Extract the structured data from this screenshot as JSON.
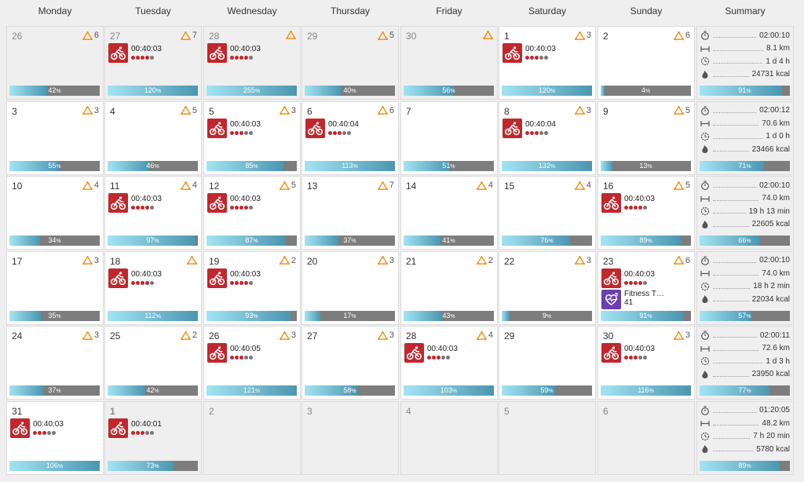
{
  "headers": [
    "Monday",
    "Tuesday",
    "Wednesday",
    "Thursday",
    "Friday",
    "Saturday",
    "Sunday",
    "Summary"
  ],
  "weeks": [
    {
      "days": [
        {
          "num": "26",
          "other": true,
          "load": "6",
          "bar": 42
        },
        {
          "num": "27",
          "other": true,
          "load": "7",
          "bar": 120,
          "activity": {
            "duration": "00:40:03",
            "dots": 4
          }
        },
        {
          "num": "28",
          "other": true,
          "load": "",
          "bar": 255,
          "activity": {
            "duration": "00:40:03",
            "dots": 4
          }
        },
        {
          "num": "29",
          "other": true,
          "load": "5",
          "bar": 40
        },
        {
          "num": "30",
          "other": true,
          "load": "",
          "bar": 56
        },
        {
          "num": "1",
          "load": "3",
          "bar": 120,
          "activity": {
            "duration": "00:40:03",
            "dots": 3
          }
        },
        {
          "num": "2",
          "load": "6",
          "bar": 4
        }
      ],
      "summary": {
        "time": "02:00:10",
        "distance": "8.1 km",
        "duration": "1 d 4 h",
        "energy": "24731 kcal",
        "bar": 91
      }
    },
    {
      "days": [
        {
          "num": "3",
          "load": "3",
          "bar": 55
        },
        {
          "num": "4",
          "load": "5",
          "bar": 46
        },
        {
          "num": "5",
          "load": "3",
          "bar": 85,
          "activity": {
            "duration": "00:40:03",
            "dots": 3
          }
        },
        {
          "num": "6",
          "load": "6",
          "bar": 113,
          "activity": {
            "duration": "00:40:04",
            "dots": 3
          }
        },
        {
          "num": "7",
          "load": null,
          "bar": 51
        },
        {
          "num": "8",
          "load": "3",
          "bar": 132,
          "activity": {
            "duration": "00:40:04",
            "dots": 3
          }
        },
        {
          "num": "9",
          "load": "5",
          "bar": 13
        }
      ],
      "summary": {
        "time": "02:00:12",
        "distance": "70.6 km",
        "duration": "1 d 0 h",
        "energy": "23466 kcal",
        "bar": 71
      }
    },
    {
      "days": [
        {
          "num": "10",
          "load": "4",
          "bar": 34
        },
        {
          "num": "11",
          "load": "4",
          "bar": 97,
          "activity": {
            "duration": "00:40:03",
            "dots": 4
          }
        },
        {
          "num": "12",
          "load": "5",
          "bar": 87,
          "activity": {
            "duration": "00:40:03",
            "dots": 4
          }
        },
        {
          "num": "13",
          "load": "7",
          "bar": 37
        },
        {
          "num": "14",
          "load": "4",
          "bar": 41
        },
        {
          "num": "15",
          "load": "4",
          "bar": 76
        },
        {
          "num": "16",
          "load": "5",
          "bar": 89,
          "activity": {
            "duration": "00:40:03",
            "dots": 4
          }
        }
      ],
      "summary": {
        "time": "02:00:10",
        "distance": "74.0 km",
        "duration": "19 h 13 min",
        "energy": "22605 kcal",
        "bar": 66
      }
    },
    {
      "days": [
        {
          "num": "17",
          "load": "3",
          "bar": 35
        },
        {
          "num": "18",
          "load": "",
          "bar": 112,
          "activity": {
            "duration": "00:40:03",
            "dots": 4
          }
        },
        {
          "num": "19",
          "load": "2",
          "bar": 93,
          "activity": {
            "duration": "00:40:03",
            "dots": 4
          }
        },
        {
          "num": "20",
          "load": "3",
          "bar": 17
        },
        {
          "num": "21",
          "load": "2",
          "bar": 43
        },
        {
          "num": "22",
          "load": "3",
          "bar": 9
        },
        {
          "num": "23",
          "load": "6",
          "bar": 91,
          "activity": {
            "duration": "00:40:03",
            "dots": 4
          },
          "fitness": {
            "label": "Fitness T…",
            "value": "41"
          }
        }
      ],
      "summary": {
        "time": "02:00:10",
        "distance": "74.0 km",
        "duration": "18 h 2 min",
        "energy": "22034 kcal",
        "bar": 57
      }
    },
    {
      "days": [
        {
          "num": "24",
          "load": "3",
          "bar": 37
        },
        {
          "num": "25",
          "load": "2",
          "bar": 42
        },
        {
          "num": "26",
          "load": "3",
          "bar": 121,
          "activity": {
            "duration": "00:40:05",
            "dots": 3
          }
        },
        {
          "num": "27",
          "load": "3",
          "bar": 58
        },
        {
          "num": "28",
          "load": "4",
          "bar": 103,
          "activity": {
            "duration": "00:40:03",
            "dots": 3
          }
        },
        {
          "num": "29",
          "load": null,
          "bar": 59
        },
        {
          "num": "30",
          "load": "3",
          "bar": 116,
          "activity": {
            "duration": "00:40:03",
            "dots": 3
          }
        }
      ],
      "summary": {
        "time": "02:00:11",
        "distance": "72.6 km",
        "duration": "1 d 3 h",
        "energy": "23950 kcal",
        "bar": 77
      }
    },
    {
      "days": [
        {
          "num": "31",
          "load": null,
          "bar": 106,
          "activity": {
            "duration": "00:40:03",
            "dots": 3
          }
        },
        {
          "num": "1",
          "other": true,
          "today": true,
          "load": null,
          "bar": 73,
          "activity": {
            "duration": "00:40:01",
            "dots": 3
          }
        },
        {
          "num": "2",
          "other": true,
          "load": null,
          "bar": null
        },
        {
          "num": "3",
          "other": true,
          "load": null,
          "bar": null
        },
        {
          "num": "4",
          "other": true,
          "load": null,
          "bar": null
        },
        {
          "num": "5",
          "other": true,
          "load": null,
          "bar": null
        },
        {
          "num": "6",
          "other": true,
          "load": null,
          "bar": null
        }
      ],
      "summary": {
        "time": "01:20:05",
        "distance": "48.2 km",
        "duration": "7 h 20 min",
        "energy": "5780 kcal",
        "bar": 89
      }
    }
  ],
  "percent_sign": "%",
  "colors": {
    "activity_red": "#c1272d",
    "fitness_purple": "#6a3fb0",
    "load_orange": "#f0941d",
    "bar_fill_start": "#a3e4f3",
    "bar_fill_end": "#4b96b0",
    "bar_bg": "#7d7d7d"
  },
  "icons": {
    "activity": "cycling-icon",
    "fitness": "fitness-test-icon",
    "load": "training-load-icon",
    "summary": [
      "stopwatch-icon",
      "distance-icon",
      "duration-icon",
      "flame-icon"
    ]
  }
}
